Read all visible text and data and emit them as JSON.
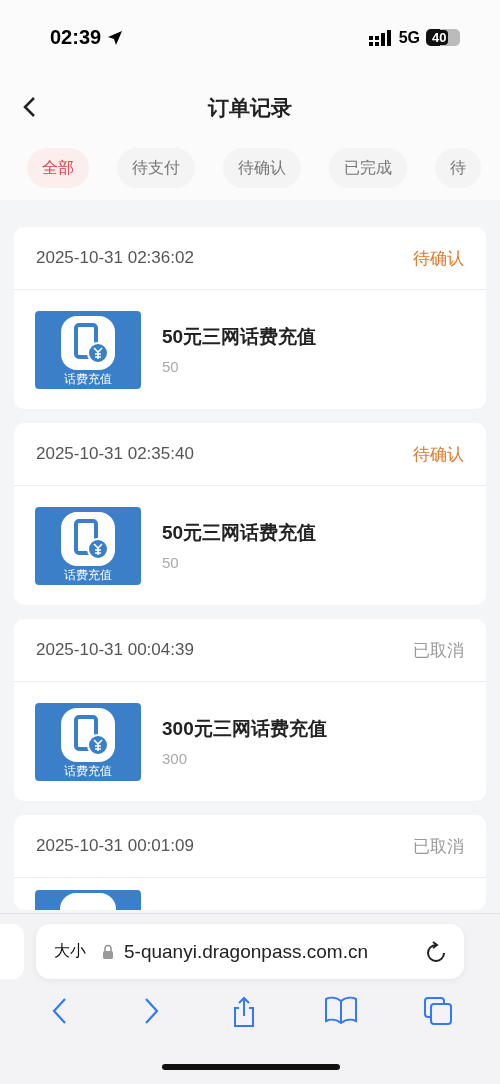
{
  "status_bar": {
    "time": "02:39",
    "network": "5G",
    "battery": "40"
  },
  "header": {
    "title": "订单记录"
  },
  "tabs": [
    {
      "label": "全部",
      "selected": true
    },
    {
      "label": "待支付",
      "selected": false
    },
    {
      "label": "待确认",
      "selected": false
    },
    {
      "label": "已完成",
      "selected": false
    },
    {
      "label": "待",
      "selected": false
    }
  ],
  "orders": [
    {
      "time": "2025-10-31 02:36:02",
      "status": {
        "text": "待确认",
        "kind": "pending"
      },
      "product": {
        "thumb_label": "话费充值",
        "name": "50元三网话费充值",
        "amount": "50"
      }
    },
    {
      "time": "2025-10-31 02:35:40",
      "status": {
        "text": "待确认",
        "kind": "pending"
      },
      "product": {
        "thumb_label": "话费充值",
        "name": "50元三网话费充值",
        "amount": "50"
      }
    },
    {
      "time": "2025-10-31 00:04:39",
      "status": {
        "text": "已取消",
        "kind": "cancelled"
      },
      "product": {
        "thumb_label": "话费充值",
        "name": "300元三网话费充值",
        "amount": "300"
      }
    },
    {
      "time": "2025-10-31 00:01:09",
      "status": {
        "text": "已取消",
        "kind": "cancelled"
      }
    }
  ],
  "browser": {
    "text_size": "大小",
    "url": "5-quanyi.dragonpass.com.cn"
  }
}
